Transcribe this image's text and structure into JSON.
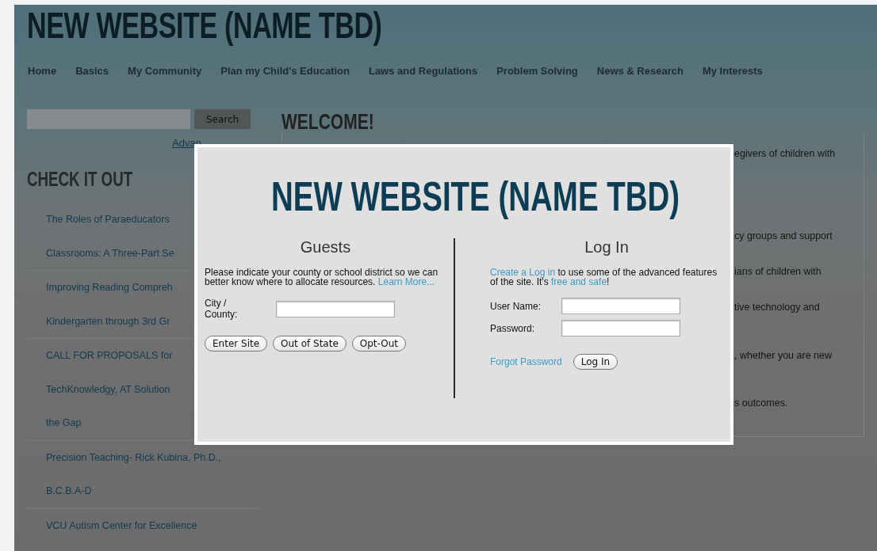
{
  "site_title": "NEW WEBSITE (NAME TBD)",
  "nav": [
    "Home",
    "Basics",
    "My Community",
    "Plan my Child's Education",
    "Laws and Regulations",
    "Problem Solving",
    "News & Research",
    "My Interests"
  ],
  "sidebar": {
    "search_button": "Search",
    "advanced_link": "Advan",
    "heading": "CHECK IT OUT",
    "links": [
      {
        "lines": [
          "The Roles of Paraeducators",
          "Classrooms: A Three-Part Se"
        ]
      },
      {
        "lines": [
          "Improving Reading Compreh",
          "Kindergarten through 3rd Gr"
        ]
      },
      {
        "lines": [
          "CALL FOR PROPOSALS for",
          "TechKnowledgy, AT Solution",
          "the Gap"
        ]
      },
      {
        "lines": [
          "Precision Teaching- Rick Kubina, Ph.D.,",
          "B.C.B.A-D"
        ]
      },
      {
        "lines": [
          "VCU Autism Center for Excellence"
        ]
      }
    ]
  },
  "main": {
    "heading": "WELCOME!",
    "fragments": [
      "egivers of children with",
      "cy groups and support",
      "ians of children with",
      "tive technology and",
      ", whether you are new",
      "s outcomes."
    ]
  },
  "modal": {
    "title": "NEW WEBSITE (NAME TBD)",
    "guests": {
      "heading": "Guests",
      "text": "Please indicate your county or school district so we can better know where to allocate resources. ",
      "link": "Learn More...",
      "field_label": "City / County:",
      "buttons": [
        "Enter Site",
        "Out of State",
        "Opt-Out"
      ]
    },
    "login": {
      "heading": "Log In",
      "intro": [
        {
          "kind": "link",
          "text": "Create a Log in"
        },
        {
          "kind": "text",
          "text": " to use some of the advanced features of the site. It's "
        },
        {
          "kind": "link",
          "text": "free and safe"
        },
        {
          "kind": "text",
          "text": "!"
        }
      ],
      "fields": [
        "User Name:",
        "Password:"
      ],
      "forgot_link": "Forgot Password",
      "button": "Log In"
    }
  }
}
